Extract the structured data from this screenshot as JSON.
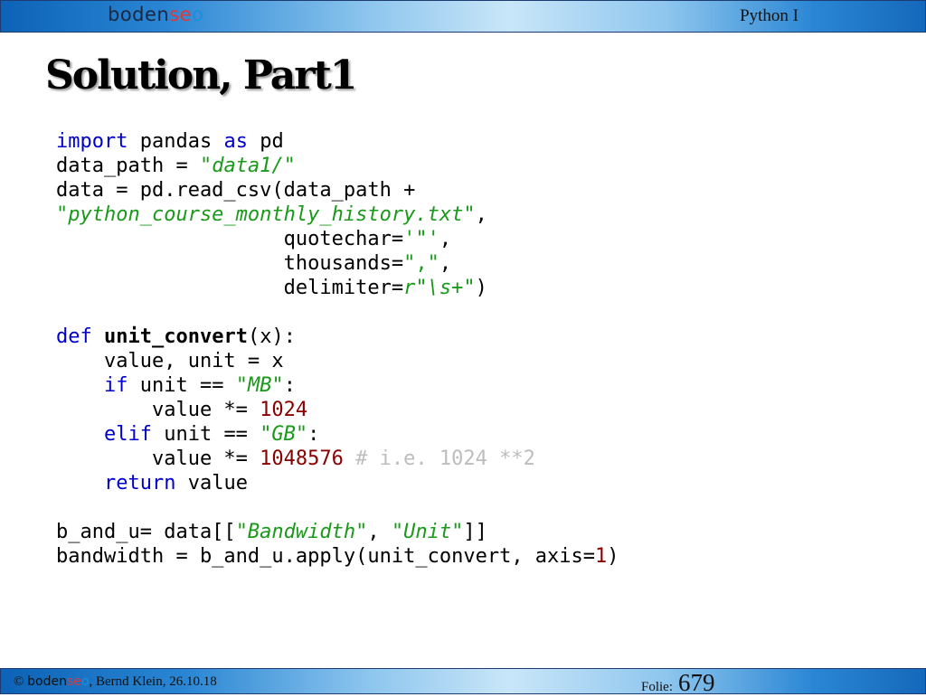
{
  "header": {
    "logo": {
      "part1": "boden",
      "part2": "se",
      "part3": "o"
    },
    "course": "Python I"
  },
  "slide": {
    "title": "Solution, Part1"
  },
  "code": {
    "language": "python",
    "lines": [
      "import pandas as pd",
      "data_path = \"data1/\"",
      "data = pd.read_csv(data_path +",
      "\"python_course_monthly_history.txt\",",
      "                   quotechar='\"',",
      "                   thousands=\",\",",
      "                   delimiter=r\"\\s+\")",
      "",
      "def unit_convert(x):",
      "    value, unit = x",
      "    if unit == \"MB\":",
      "        value *= 1024",
      "    elif unit == \"GB\":",
      "        value *= 1048576 # i.e. 1024 **2",
      "    return value",
      "",
      "b_and_u= data[[\"Bandwidth\", \"Unit\"]]",
      "bandwidth = b_and_u.apply(unit_convert, axis=1)"
    ]
  },
  "footer": {
    "copyright": "©",
    "brand": {
      "part1": "boden",
      "part2": "se",
      "part3": "o"
    },
    "author_date": ", Bernd Klein, 26.10.18",
    "folie_label": "Folie:",
    "folie_number": "679"
  },
  "colors": {
    "bar_dark": "#0d63b7",
    "bar_light": "#c9e6f8",
    "keyword": "#0000cc",
    "string": "#1a9a1a",
    "number": "#880000",
    "comment": "#bdbdbd",
    "logo_accent_red": "#e03838",
    "logo_accent_blue": "#1c8fd8"
  }
}
